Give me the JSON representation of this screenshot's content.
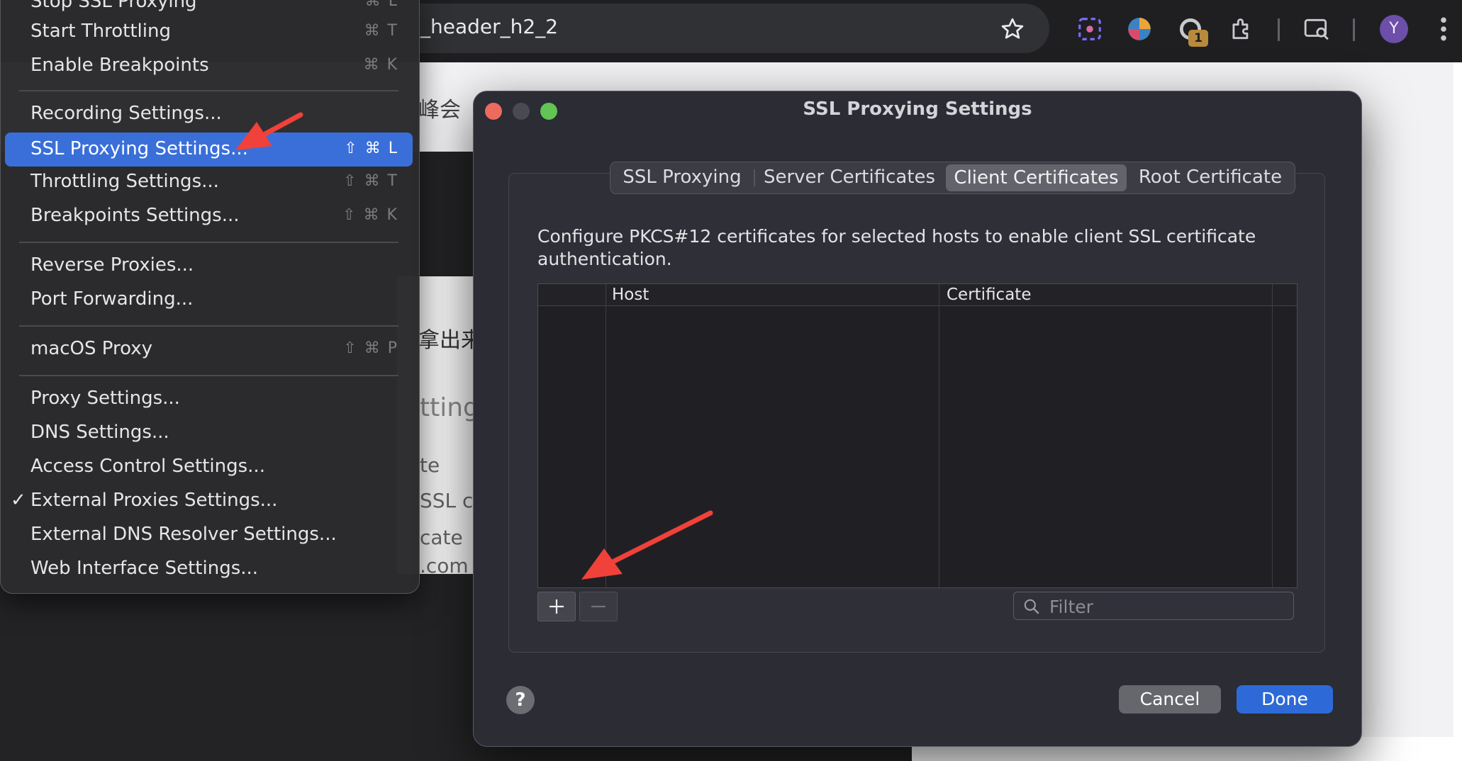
{
  "browser": {
    "url_text": "_header_h2_2",
    "extension_badge": "1",
    "profile_initial": "Y",
    "page_fragments": [
      "峰会",
      "拿出来",
      "tting",
      "te",
      "SSL c",
      "cate",
      ".com"
    ]
  },
  "menu": {
    "items": [
      {
        "label": "Stop SSL Proxying",
        "shortcut": "⌘ L"
      },
      {
        "label": "Start Throttling",
        "shortcut": "⌘ T"
      },
      {
        "label": "Enable Breakpoints",
        "shortcut": "⌘ K"
      },
      {
        "label": "Recording Settings...",
        "shortcut": ""
      },
      {
        "label": "SSL Proxying Settings...",
        "shortcut": "⇧ ⌘ L",
        "highlighted": true
      },
      {
        "label": "Throttling Settings...",
        "shortcut": "⇧ ⌘ T"
      },
      {
        "label": "Breakpoints Settings...",
        "shortcut": "⇧ ⌘ K"
      },
      {
        "label": "Reverse Proxies...",
        "shortcut": ""
      },
      {
        "label": "Port Forwarding...",
        "shortcut": ""
      },
      {
        "label": "macOS Proxy",
        "shortcut": "⇧ ⌘ P"
      },
      {
        "label": "Proxy Settings...",
        "shortcut": ""
      },
      {
        "label": "DNS Settings...",
        "shortcut": ""
      },
      {
        "label": "Access Control Settings...",
        "shortcut": ""
      },
      {
        "label": "External Proxies Settings...",
        "shortcut": "",
        "checked": true
      },
      {
        "label": "External DNS Resolver Settings...",
        "shortcut": ""
      },
      {
        "label": "Web Interface Settings...",
        "shortcut": ""
      }
    ],
    "checkmark": "✓"
  },
  "dialog": {
    "title": "SSL Proxying Settings",
    "tabs": [
      {
        "label": "SSL Proxying"
      },
      {
        "label": "Server Certificates"
      },
      {
        "label": "Client Certificates",
        "selected": true
      },
      {
        "label": "Root Certificate"
      }
    ],
    "description": "Configure PKCS#12 certificates for selected hosts to enable client SSL certificate authentication.",
    "table": {
      "columns": [
        "",
        "Host",
        "Certificate",
        ""
      ],
      "rows": []
    },
    "add_label": "+",
    "remove_label": "−",
    "filter_placeholder": "Filter",
    "help_label": "?",
    "cancel_label": "Cancel",
    "done_label": "Done"
  },
  "colors": {
    "menu_highlight": "#3a6fd9",
    "done_button": "#2d6ad8",
    "annotation_arrow": "#f0413a",
    "traffic_close": "#ed6a5e",
    "traffic_minimize": "#4a4b51",
    "traffic_zoom": "#61c454"
  }
}
